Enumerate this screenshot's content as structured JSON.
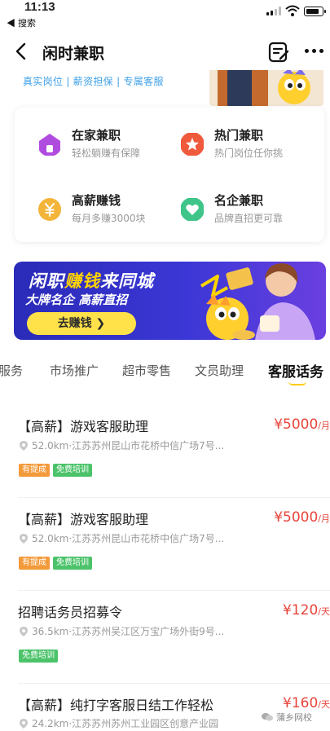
{
  "status_bar": {
    "time": "11:13",
    "back_app": "◀ 搜索"
  },
  "nav": {
    "title": "闲时兼职"
  },
  "tagline": "真实岗位 | 薪资担保 | 专属客服",
  "categories": [
    {
      "title": "在家兼职",
      "subtitle": "轻松躺赚有保障",
      "icon": "house-icon",
      "color": "#b04be0"
    },
    {
      "title": "热门兼职",
      "subtitle": "热门岗位任你挑",
      "icon": "star-icon",
      "color": "#f05a3c"
    },
    {
      "title": "高薪赚钱",
      "subtitle": "每月多赚3000块",
      "icon": "yuan-icon",
      "color": "#f3b43a"
    },
    {
      "title": "名企兼职",
      "subtitle": "品牌直招更可靠",
      "icon": "heart-icon",
      "color": "#3fc58a"
    }
  ],
  "promo": {
    "headline_a": "闲职",
    "headline_b": "赚钱",
    "headline_c": "来同城",
    "subline": "大牌名企 高薪直招",
    "button": "去赚钱 ❯"
  },
  "tabs": [
    "服务",
    "市场推广",
    "超市零售",
    "文员助理",
    "客服话务"
  ],
  "active_tab": "客服话务",
  "jobs": [
    {
      "title": "【高薪】游戏客服助理",
      "location": "52.0km·江苏苏州昆山市花桥中信广场7号...",
      "tags": [
        {
          "label": "有提成",
          "color": "orange"
        },
        {
          "label": "免费培训",
          "color": "green"
        }
      ],
      "pay": "¥5000",
      "unit": "/月"
    },
    {
      "title": "【高薪】游戏客服助理",
      "location": "52.0km·江苏苏州昆山市花桥中信广场7号...",
      "tags": [
        {
          "label": "有提成",
          "color": "orange"
        },
        {
          "label": "免费培训",
          "color": "green"
        }
      ],
      "pay": "¥5000",
      "unit": "/月"
    },
    {
      "title": "招聘话务员招募令",
      "location": "36.5km·江苏苏州吴江区万宝广场外街9号...",
      "tags": [
        {
          "label": "免费培训",
          "color": "green"
        }
      ],
      "pay": "¥120",
      "unit": "/天"
    },
    {
      "title": "【高薪】纯打字客服日结工作轻松",
      "location": "24.2km·江苏苏州苏州工业园区创意产业园",
      "tags": [],
      "pay": "¥160",
      "unit": "/天"
    }
  ],
  "watermark": "蒲乡网校"
}
